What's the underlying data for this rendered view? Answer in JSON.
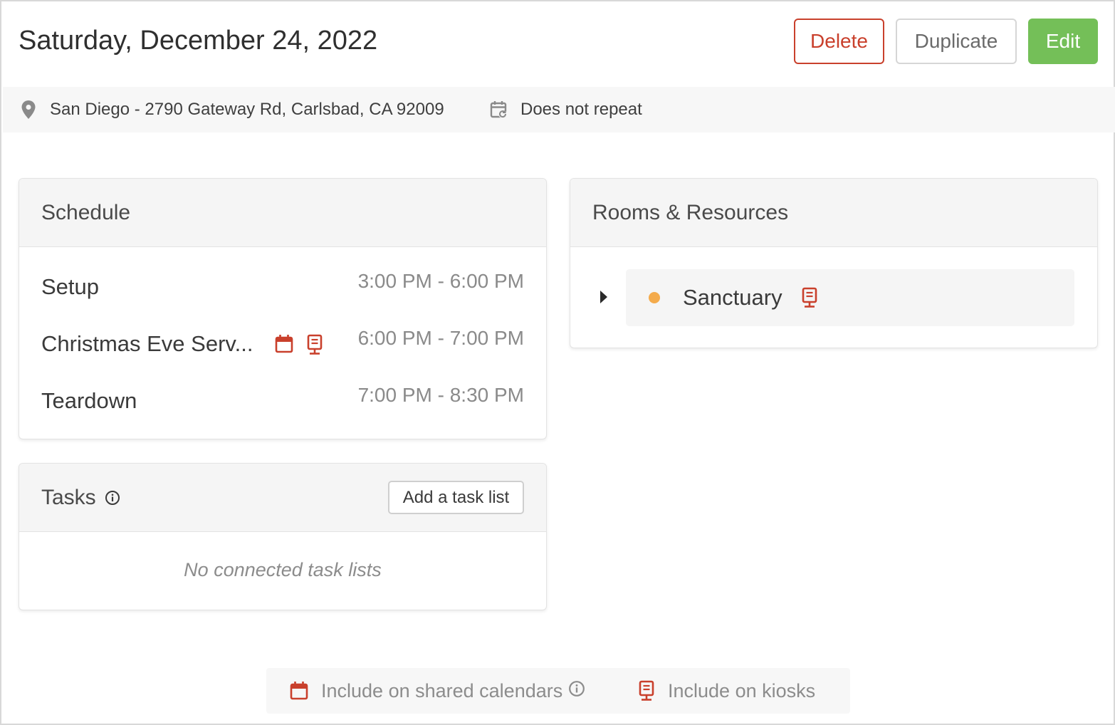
{
  "header": {
    "title": "Saturday, December 24, 2022",
    "delete_label": "Delete",
    "duplicate_label": "Duplicate",
    "edit_label": "Edit"
  },
  "info": {
    "location": "San Diego - 2790 Gateway Rd, Carlsbad, CA 92009",
    "repeat": "Does not repeat"
  },
  "schedule": {
    "title": "Schedule",
    "items": [
      {
        "name": "Setup",
        "time": "3:00 PM - 6:00 PM"
      },
      {
        "name": "Christmas Eve Serv...",
        "time": "6:00 PM - 7:00 PM"
      },
      {
        "name": "Teardown",
        "time": "7:00 PM - 8:30 PM"
      }
    ]
  },
  "tasks": {
    "title": "Tasks",
    "add_label": "Add a task list",
    "empty_text": "No connected task lists"
  },
  "rooms": {
    "title": "Rooms & Resources",
    "items": [
      {
        "name": "Sanctuary"
      }
    ]
  },
  "legend": {
    "calendars_label": "Include on shared calendars",
    "kiosks_label": "Include on kiosks"
  },
  "colors": {
    "accent_red": "#c9402c",
    "edit_green": "#74bf58",
    "room_dot": "#f4ab4c"
  },
  "icons": [
    "location-pin-icon",
    "repeat-calendar-icon",
    "calendar-icon",
    "kiosk-icon",
    "info-icon",
    "caret-right-icon"
  ]
}
